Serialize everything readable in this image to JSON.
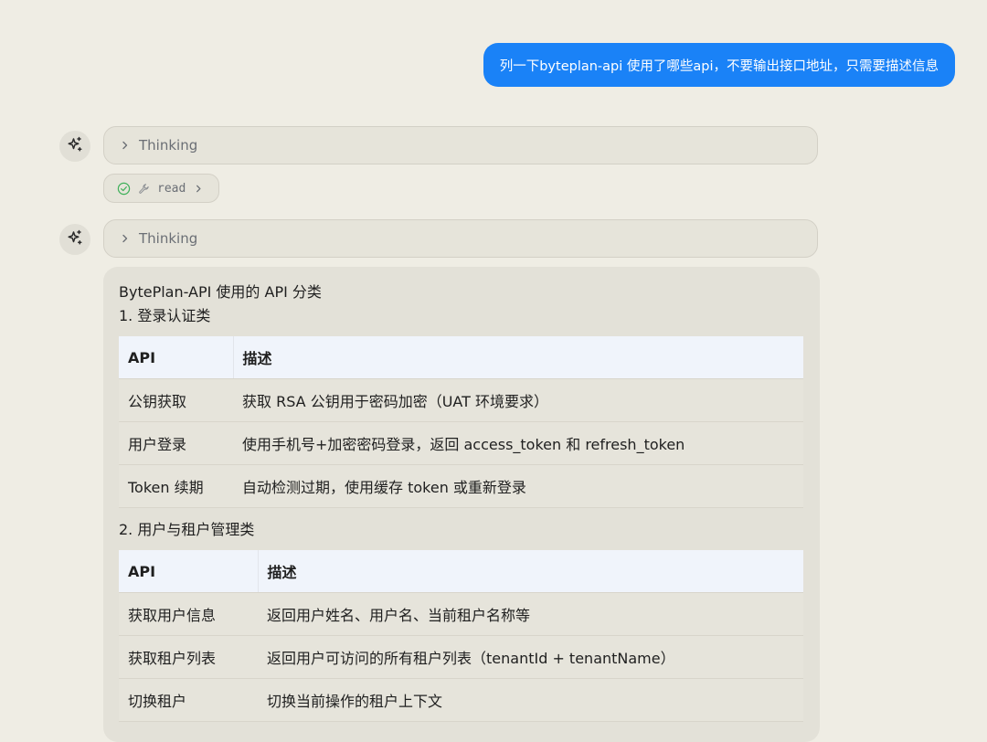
{
  "user_message": "列一下byteplan-api 使用了哪些api，不要输出接口地址，只需要描述信息",
  "thinking_label": "Thinking",
  "tool_call": {
    "name": "read",
    "status": "success"
  },
  "answer": {
    "title": "BytePlan-API 使用的 API 分类",
    "sections": [
      {
        "heading": "1. 登录认证类",
        "columns": [
          "API",
          "描述"
        ],
        "rows": [
          [
            "公钥获取",
            "获取 RSA 公钥用于密码加密（UAT 环境要求）"
          ],
          [
            "用户登录",
            "使用手机号+加密密码登录，返回 access_token 和 refresh_token"
          ],
          [
            "Token 续期",
            "自动检测过期，使用缓存 token 或重新登录"
          ]
        ]
      },
      {
        "heading": "2. 用户与租户管理类",
        "columns": [
          "API",
          "描述"
        ],
        "rows": [
          [
            "获取用户信息",
            "返回用户姓名、用户名、当前租户名称等"
          ],
          [
            "获取租户列表",
            "返回用户可访问的所有租户列表（tenantId + tenantName）"
          ],
          [
            "切换租户",
            "切换当前操作的租户上下文"
          ]
        ]
      }
    ]
  },
  "colors": {
    "background": "#efede4",
    "user_bubble": "#1a82f7",
    "success": "#3fb05a"
  }
}
